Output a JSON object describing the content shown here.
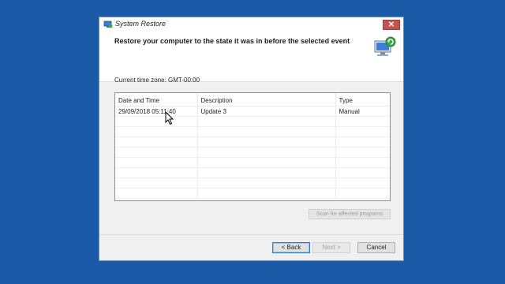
{
  "window": {
    "title": "System Restore",
    "close_glyph": "✕"
  },
  "header": {
    "heading": "Restore your computer to the state it was in before the selected event",
    "icon": "system-restore-icon"
  },
  "timezone": "Current time zone: GMT-00:00",
  "table": {
    "columns": [
      "Date and Time",
      "Description",
      "Type"
    ],
    "rows": [
      {
        "date": "29/09/2018 05:11:40",
        "description": "Update 3",
        "type": "Manual"
      }
    ]
  },
  "buttons": {
    "scan": "Scan for affected programs",
    "back": "< Back",
    "next": "Next >",
    "cancel": "Cancel"
  },
  "colors": {
    "desktop": "#1b5aa6",
    "close": "#c75050",
    "accent": "#2b74c8"
  }
}
